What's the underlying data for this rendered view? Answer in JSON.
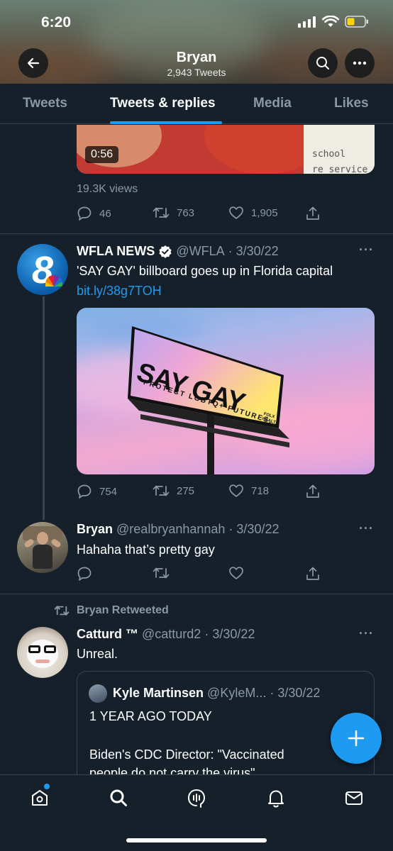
{
  "status_bar": {
    "time": "6:20"
  },
  "header": {
    "name": "Bryan",
    "tweet_count": "2,943 Tweets"
  },
  "tabs": [
    {
      "label": "Tweets",
      "active": false
    },
    {
      "label": "Tweets & replies",
      "active": true
    },
    {
      "label": "Media",
      "active": false
    },
    {
      "label": "Likes",
      "active": false
    }
  ],
  "tweet0": {
    "video_duration": "0:56",
    "video_text_line1": "school",
    "video_text_line2": "re service",
    "views": "19.3K views",
    "replies": "46",
    "retweets": "763",
    "likes": "1,905"
  },
  "tweet1": {
    "name": "WFLA NEWS",
    "verified_icon": "verified-badge-icon",
    "handle": "@WFLA",
    "date": "3/30/22",
    "text": "'SAY GAY' billboard goes up in Florida capital",
    "link": "bit.ly/38g7TOH",
    "avatar_text": "8",
    "billboard_title": "SAY GAY",
    "billboard_subtitle": "PROTECT LGBTQ+ FUTURES.",
    "billboard_tag": "FOLX HEALTH",
    "replies": "754",
    "retweets": "275",
    "likes": "718"
  },
  "tweet2": {
    "name": "Bryan",
    "handle": "@realbryanhannah",
    "date": "3/30/22",
    "text": "Hahaha that’s pretty gay"
  },
  "tweet3": {
    "retweeted_label": "Bryan Retweeted",
    "name": "Catturd ™",
    "handle": "@catturd2",
    "date": "3/30/22",
    "text": "Unreal.",
    "quote": {
      "name": "Kyle Martinsen",
      "handle": "@KyleM...",
      "date": "3/30/22",
      "line1": "1 YEAR AGO TODAY",
      "line2": "Biden's CDC Director: \"Vaccinated",
      "line3": "people do not carry the virus\""
    }
  },
  "colors": {
    "accent": "#1d9bf0",
    "background": "#15202b",
    "muted": "#8b98a5",
    "border": "#38444d"
  },
  "bottom_nav": [
    "home-icon",
    "search-icon",
    "spaces-icon",
    "notifications-icon",
    "messages-icon"
  ]
}
